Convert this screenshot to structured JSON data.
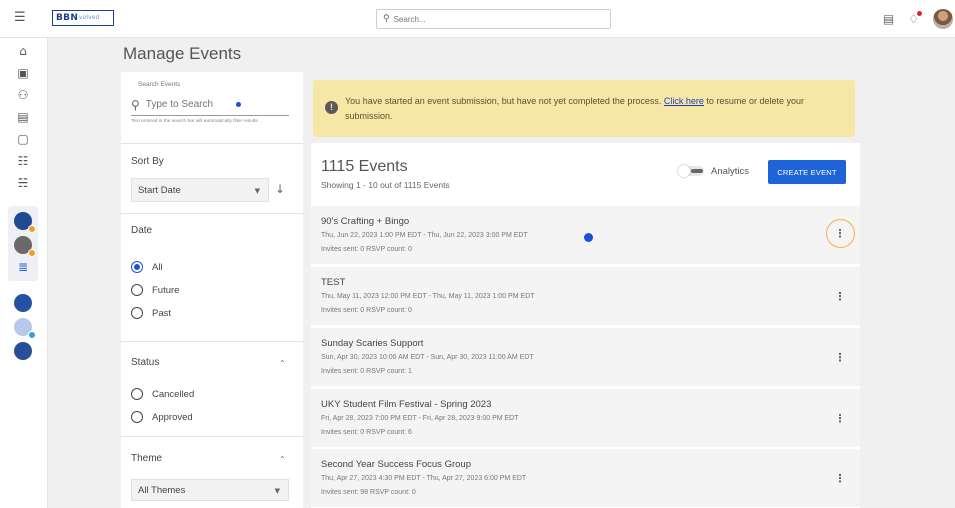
{
  "topbar": {
    "logo_main": "BBN",
    "logo_sub": "volved",
    "search_placeholder": "Search..."
  },
  "page": {
    "title": "Manage Events"
  },
  "filters": {
    "search_label": "Search Events",
    "search_placeholder": "Type to Search",
    "search_helper": "Text entered in the search bar will automatically filter results.",
    "sort_label": "Sort By",
    "sort_value": "Start Date",
    "date_label": "Date",
    "date_options": [
      "All",
      "Future",
      "Past"
    ],
    "status_label": "Status",
    "status_options": [
      "Cancelled",
      "Approved"
    ],
    "theme_label": "Theme",
    "theme_value": "All Themes"
  },
  "alert": {
    "text_before": "You have started an event submission, but have not yet completed the process.",
    "link": "Click here",
    "text_after": "to resume or delete your submission."
  },
  "events": {
    "count": "1115 Events",
    "showing": "Showing 1 - 10 out of 1115 Events",
    "analytics_label": "Analytics",
    "create_label": "CREATE EVENT",
    "rows": [
      {
        "title": "90's Crafting + Bingo",
        "date": "Thu, Jun 22, 2023 1:00 PM EDT - Thu, Jun 22, 2023 3:00 PM EDT",
        "counts": "Invites sent: 0    RSVP count: 0"
      },
      {
        "title": "TEST",
        "date": "Thu, May 11, 2023 12:00 PM EDT - Thu, May 11, 2023 1:00 PM EDT",
        "counts": "Invites sent: 0    RSVP count: 0"
      },
      {
        "title": "Sunday Scaries Support",
        "date": "Sun, Apr 30, 2023 10:00 AM EDT - Sun, Apr 30, 2023 11:00 AM EDT",
        "counts": "Invites sent: 0    RSVP count: 1"
      },
      {
        "title": "UKY Student Film Festival - Spring 2023",
        "date": "Fri, Apr 28, 2023 7:00 PM EDT - Fri, Apr 28, 2023 9:00 PM EDT",
        "counts": "Invites sent: 0    RSVP count: 6"
      },
      {
        "title": "Second Year Success Focus Group",
        "date": "Thu, Apr 27, 2023 4:30 PM EDT - Thu, Apr 27, 2023 6:00 PM EDT",
        "counts": "Invites sent: 98    RSVP count: 0"
      }
    ]
  },
  "icons": {
    "menu": "menu-collapse-icon",
    "home": "home-icon",
    "calendar": "calendar-icon",
    "people": "people-icon",
    "form": "form-icon",
    "document": "document-icon",
    "groups": "groups-icon",
    "settings": "sliders-icon"
  },
  "colors": {
    "accent": "#1f63d8",
    "alert_bg": "#f7e7a7",
    "ring": "#f2b54a"
  }
}
